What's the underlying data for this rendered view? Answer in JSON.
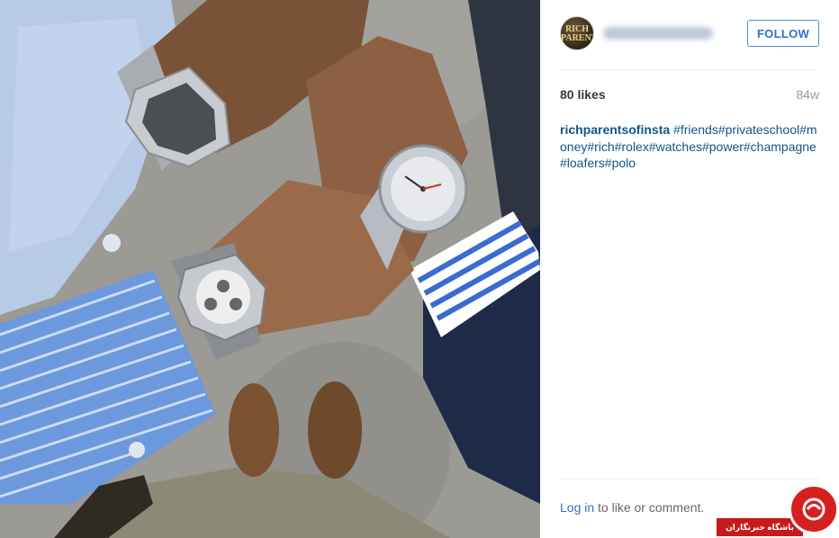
{
  "post": {
    "avatar_text": "RICH PARENTS",
    "follow_label": "FOLLOW",
    "likes": "80 likes",
    "age": "84w",
    "caption_author": "richparentsofinsta",
    "caption_text": " #friends#privateschool#money#rich#rolex#watches#power#champagne#loafers#polo",
    "login_link": "Log in",
    "login_rest": " to like or comment."
  },
  "watermark": {
    "text": "باشگاه خبرنگاران",
    "icon": "news-agency-logo-icon"
  },
  "colors": {
    "accent": "#2f72c4",
    "caption": "#125688",
    "watermark": "#c81a1a"
  }
}
